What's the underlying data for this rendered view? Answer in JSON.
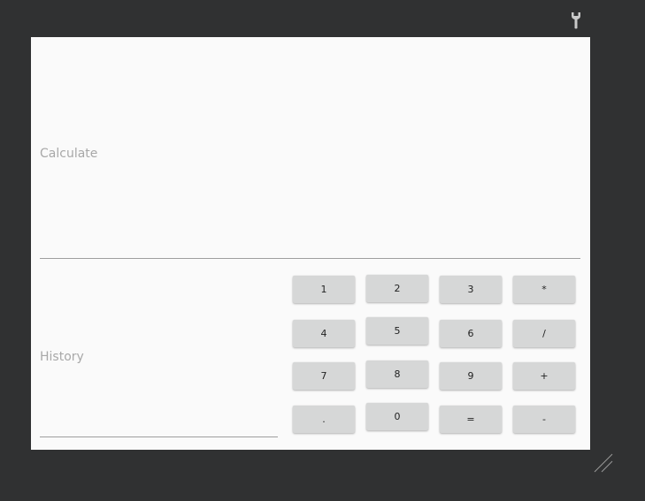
{
  "toolbar": {
    "icon": "wrench-icon"
  },
  "calculate": {
    "hint": "Calculate"
  },
  "history": {
    "hint": "History"
  },
  "keypad": {
    "k1": "1",
    "k2": "2",
    "k3": "3",
    "multiply": "*",
    "k4": "4",
    "k5": "5",
    "k6": "6",
    "divide": "/",
    "k7": "7",
    "k8": "8",
    "k9": "9",
    "plus": "+",
    "dot": ".",
    "k0": "0",
    "equals": "=",
    "minus": "-"
  },
  "window": {
    "icon": "resize-grip-icon"
  }
}
